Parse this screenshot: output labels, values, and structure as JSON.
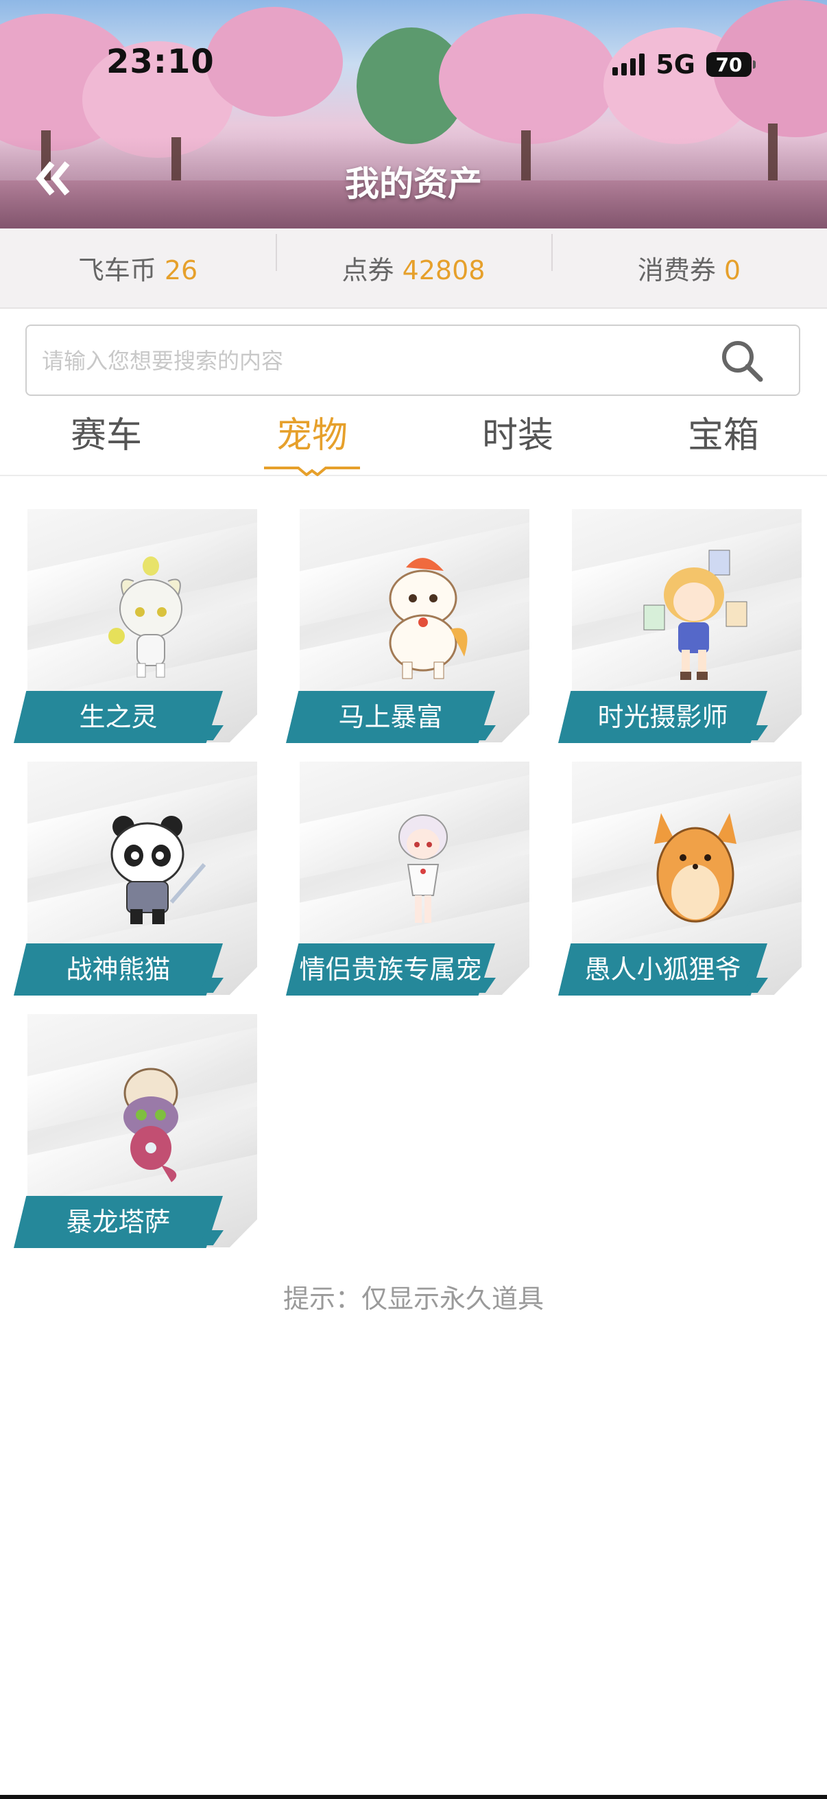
{
  "status_bar": {
    "time": "23:10",
    "network": "5G",
    "battery": "70"
  },
  "header": {
    "title": "我的资产",
    "back_icon": "double-chevron-left-icon"
  },
  "currency": [
    {
      "label": "飞车币",
      "value": "26"
    },
    {
      "label": "点券",
      "value": "42808"
    },
    {
      "label": "消费券",
      "value": "0"
    }
  ],
  "search": {
    "placeholder": "请输入您想要搜索的内容",
    "value": "",
    "icon": "search-icon"
  },
  "tabs": [
    {
      "label": "赛车",
      "active": false
    },
    {
      "label": "宠物",
      "active": true
    },
    {
      "label": "时装",
      "active": false
    },
    {
      "label": "宝箱",
      "active": false
    }
  ],
  "pets": [
    {
      "name": "生之灵",
      "icon": "spirit-pet-icon"
    },
    {
      "name": "马上暴富",
      "icon": "horse-pet-icon"
    },
    {
      "name": "时光摄影师",
      "icon": "photographer-pet-icon"
    },
    {
      "name": "战神熊猫",
      "icon": "panda-pet-icon"
    },
    {
      "name": "情侣贵族专属宠",
      "icon": "couple-pet-icon"
    },
    {
      "name": "愚人小狐狸爷",
      "icon": "fox-pet-icon"
    },
    {
      "name": "暴龙塔萨",
      "icon": "dino-pet-icon"
    }
  ],
  "hint": "提示：仅显示永久道具",
  "colors": {
    "accent": "#e6a02b",
    "label_bg": "#25889a"
  }
}
